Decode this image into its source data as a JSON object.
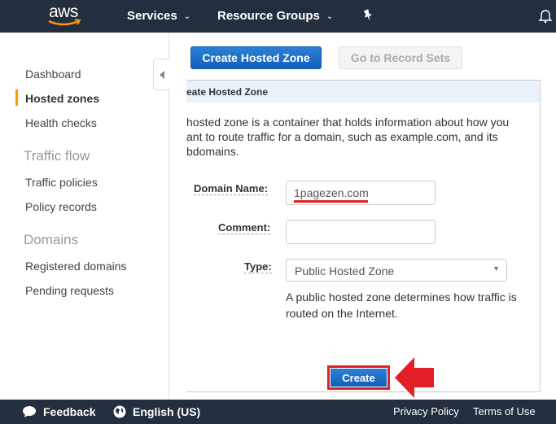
{
  "topnav": {
    "logo_text": "aws",
    "services_label": "Services",
    "resource_groups_label": "Resource Groups"
  },
  "sidebar": {
    "items": [
      {
        "label": "Dashboard"
      },
      {
        "label": "Hosted zones",
        "active": true
      },
      {
        "label": "Health checks"
      }
    ],
    "traffic_flow_heading": "Traffic flow",
    "traffic_flow_items": [
      {
        "label": "Traffic policies"
      },
      {
        "label": "Policy records"
      }
    ],
    "domains_heading": "Domains",
    "domains_items": [
      {
        "label": "Registered domains"
      },
      {
        "label": "Pending requests"
      }
    ]
  },
  "toolbar": {
    "create_hosted_zone_label": "Create Hosted Zone",
    "go_to_record_sets_label": "Go to Record Sets"
  },
  "panel": {
    "title": "eate Hosted Zone",
    "description_lines": [
      "hosted zone is a container that holds information about how you",
      "ant to route traffic for a domain, such as example.com, and its",
      "bdomains."
    ],
    "domain_name_label": "Domain Name:",
    "domain_name_value": "1pagezen.com",
    "comment_label": "Comment:",
    "comment_value": "",
    "type_label": "Type:",
    "type_value": "Public Hosted Zone",
    "type_help": "A public hosted zone determines how traffic is routed on the Internet.",
    "create_label": "Create"
  },
  "annotation": {
    "highlight_color": "#e21f26"
  },
  "footer": {
    "feedback_label": "Feedback",
    "language_label": "English (US)",
    "privacy_label": "Privacy Policy",
    "terms_label": "Terms of Use"
  },
  "colors": {
    "nav_bg": "#232f3e",
    "primary_button": "#1f6fc5",
    "active_indicator": "#ff9900"
  }
}
